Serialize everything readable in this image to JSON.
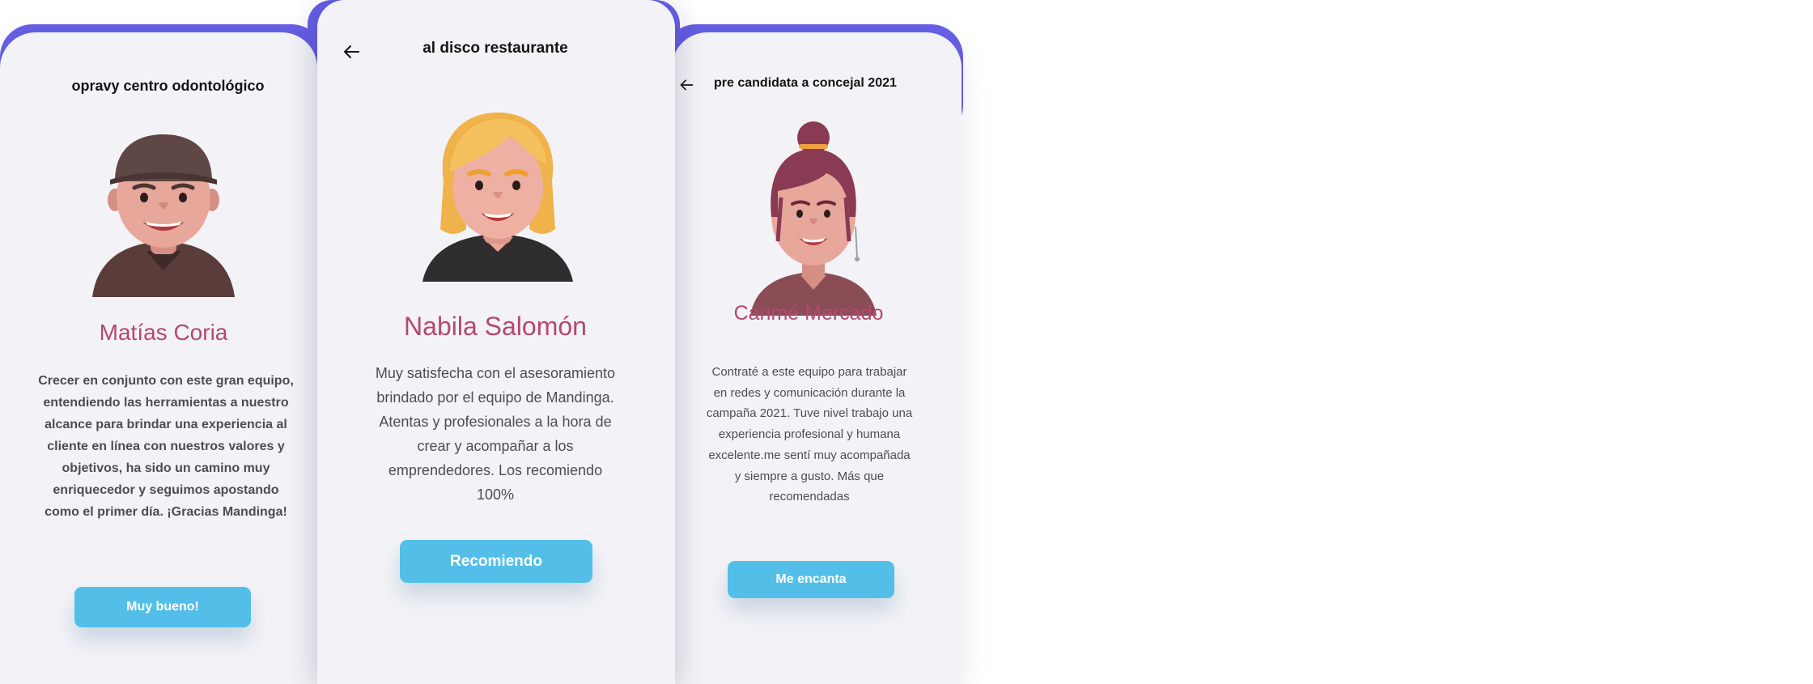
{
  "cards": [
    {
      "title": "opravy  centro odontológico",
      "back_icon": "none",
      "avatar": "man-with-cap-avatar",
      "name": "Matías Coria",
      "testimonial": "Crecer en conjunto con este gran equipo, entendiendo las herramientas a nuestro alcance para brindar una experiencia al cliente en línea con nuestros valores y objetivos, ha sido un camino muy enriquecedor y seguimos apostando como el primer día. ¡Gracias Mandinga!",
      "button": "Muy bueno!"
    },
    {
      "title": "al disco restaurante",
      "back_icon": "arrow-left-icon",
      "avatar": "blonde-woman-avatar",
      "name": "Nabila Salomón",
      "testimonial": "Muy satisfecha con el asesoramiento brindado por el equipo de Mandinga. Atentas y profesionales a la hora de crear y acompañar a los emprendedores. Los recomiendo 100%",
      "button": "Recomiendo"
    },
    {
      "title": "pre candidata a concejal 2021",
      "back_icon": "arrow-left-icon",
      "avatar": "woman-with-bun-avatar",
      "name": "Carimé Mercado",
      "testimonial": "Contraté a este equipo para trabajar en redes y comunicación durante la campaña 2021. Tuve nivel trabajo una experiencia profesional y humana excelente.me sentí muy acompañada y siempre a gusto. Más que recomendadas",
      "button": "Me encanta"
    }
  ],
  "colors": {
    "accent_purple": "#6860e6",
    "card_bg": "#f3f3f7",
    "name_pink": "#b6476f",
    "button_blue": "#53bfe8",
    "text_gray": "#4c4c54"
  }
}
